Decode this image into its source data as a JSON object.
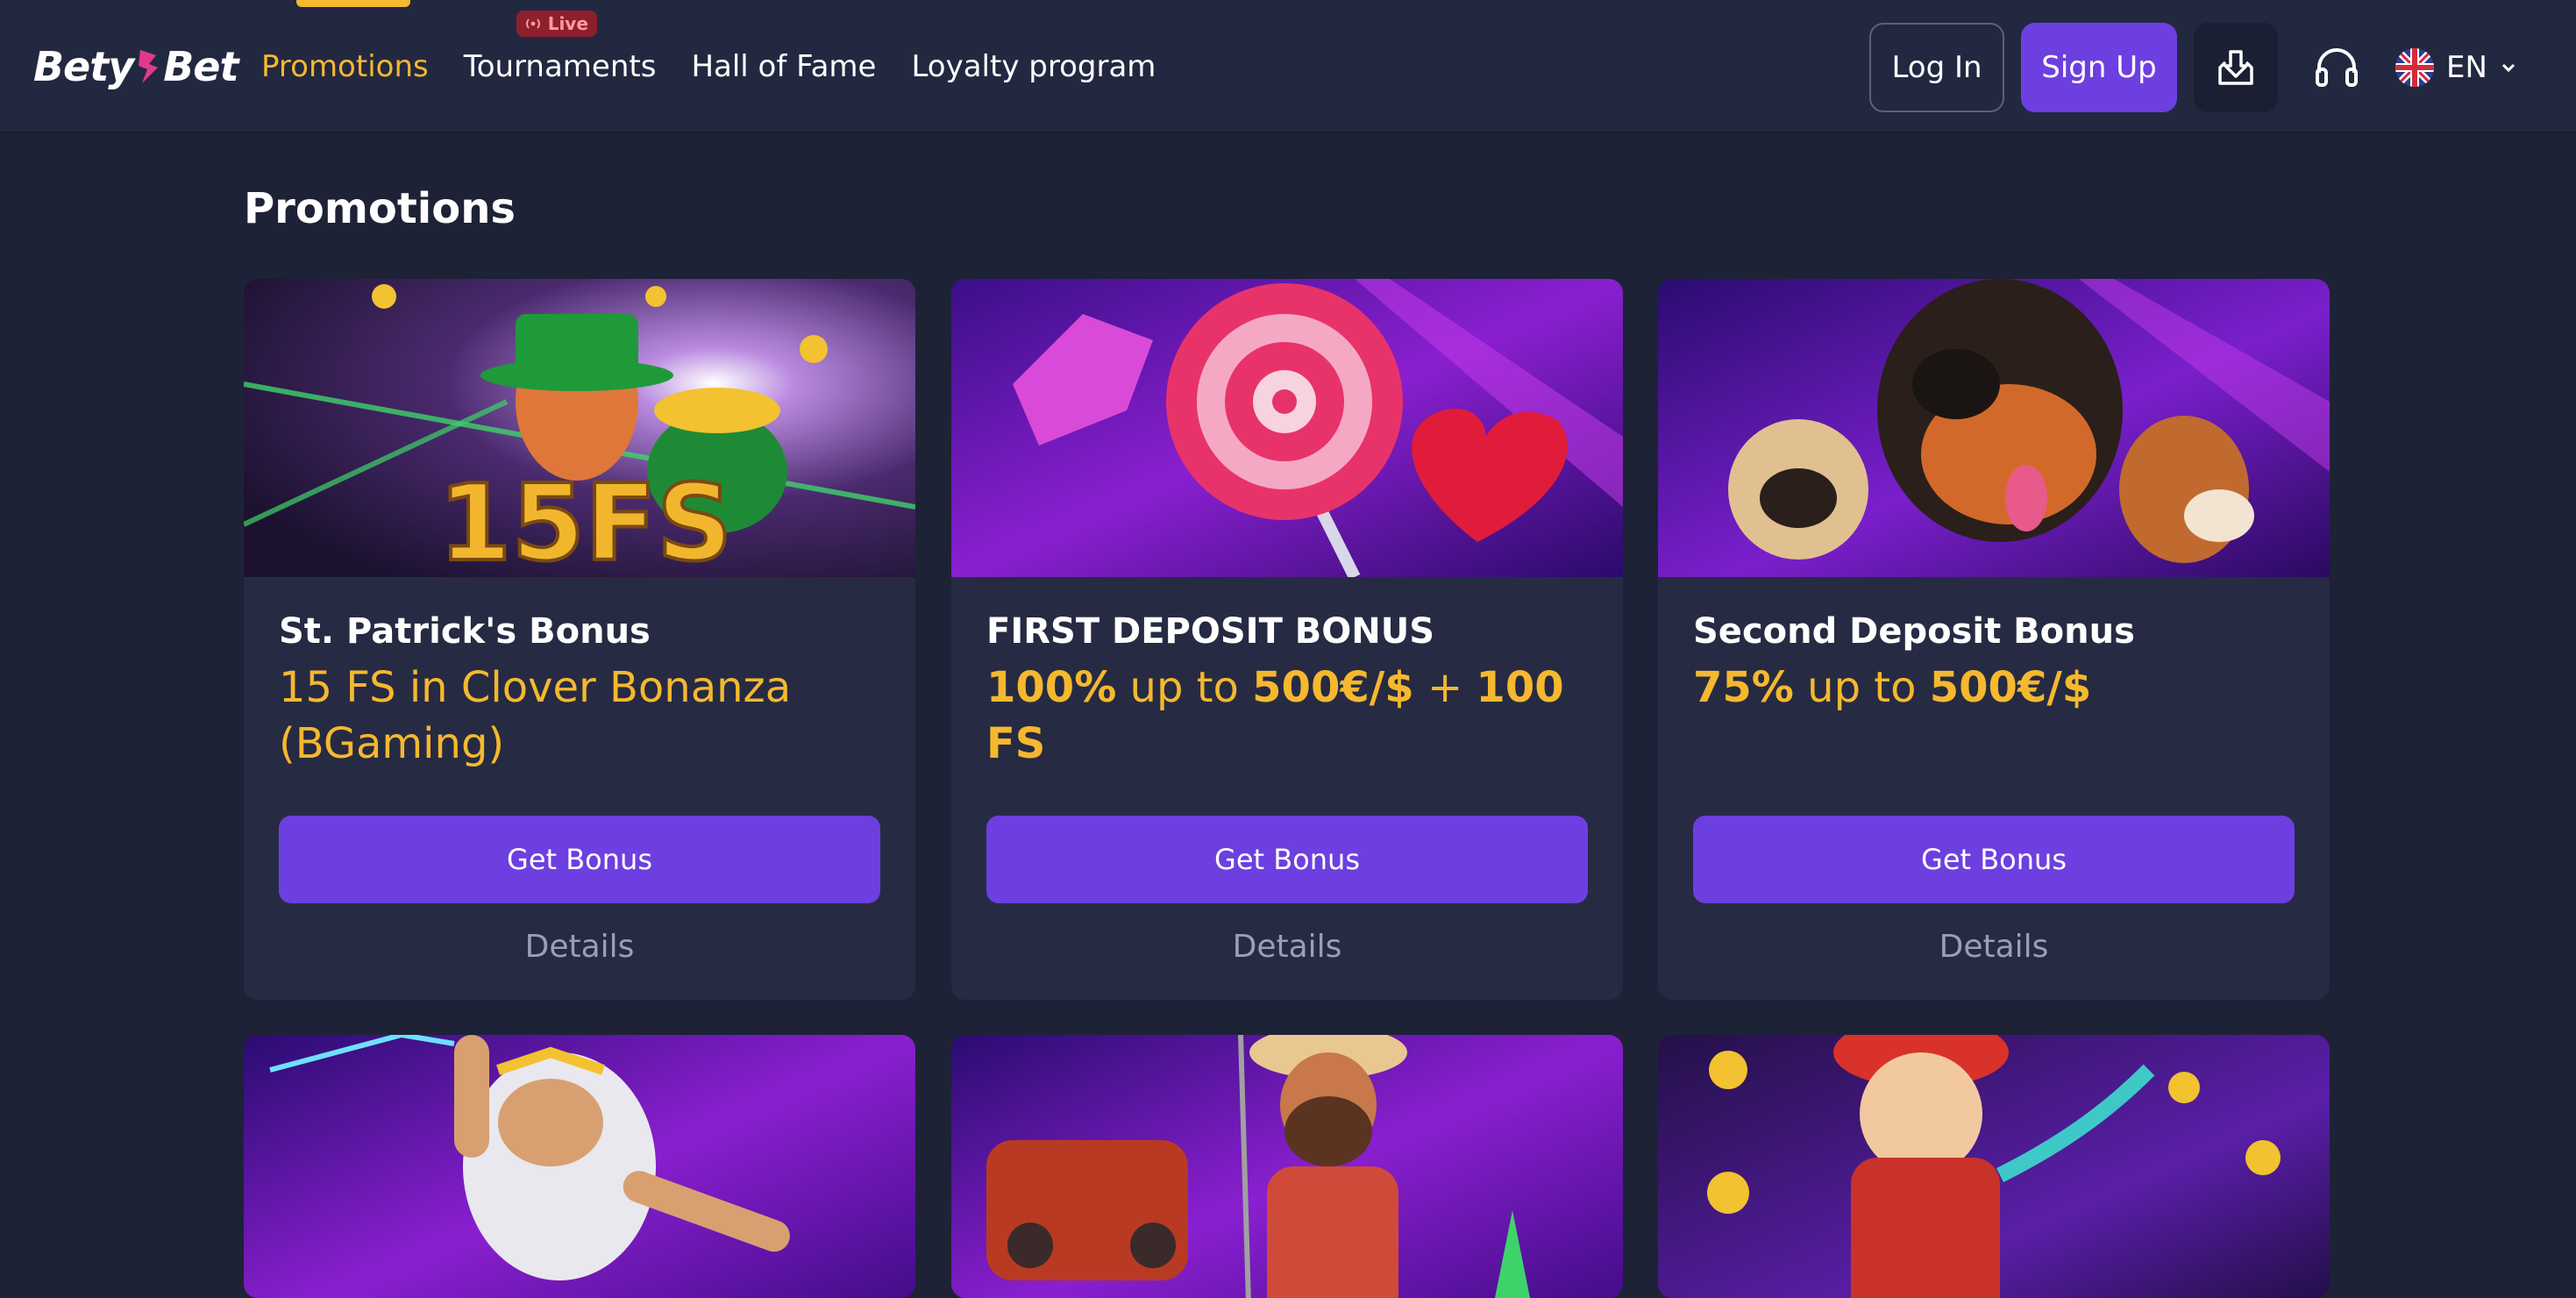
{
  "brand": {
    "logo_text_left": "Bety",
    "logo_text_right": "Bet"
  },
  "nav": {
    "items": [
      {
        "label": "Promotions",
        "active": true
      },
      {
        "label": "Tournaments",
        "badge": "Live"
      },
      {
        "label": "Hall of Fame"
      },
      {
        "label": "Loyalty program"
      }
    ]
  },
  "header_actions": {
    "login_label": "Log In",
    "signup_label": "Sign Up",
    "language": "EN",
    "icons": [
      "download-icon",
      "headset-icon",
      "uk-flag-icon",
      "chevron-down-icon"
    ]
  },
  "page": {
    "title": "Promotions"
  },
  "promotions": [
    {
      "title": "St. Patrick's Bonus",
      "subtitle": "15 FS in Clover Bonanza (BGaming)",
      "banner_text": "15FS",
      "button_label": "Get Bonus",
      "details_label": "Details"
    },
    {
      "title": "FIRST DEPOSIT BONUS",
      "subtitle_parts": [
        "100%",
        " up to ",
        "500€/$",
        " + ",
        "100 FS"
      ],
      "button_label": "Get Bonus",
      "details_label": "Details"
    },
    {
      "title": "Second Deposit Bonus",
      "subtitle_parts": [
        "75%",
        " up to ",
        "500€/$"
      ],
      "button_label": "Get Bonus",
      "details_label": "Details"
    }
  ],
  "colors": {
    "background": "#1d2236",
    "header": "#232841",
    "card": "#262b43",
    "accent_yellow": "#f5b82e",
    "accent_purple": "#6d3fe0",
    "muted_text": "#9a9fb5"
  }
}
